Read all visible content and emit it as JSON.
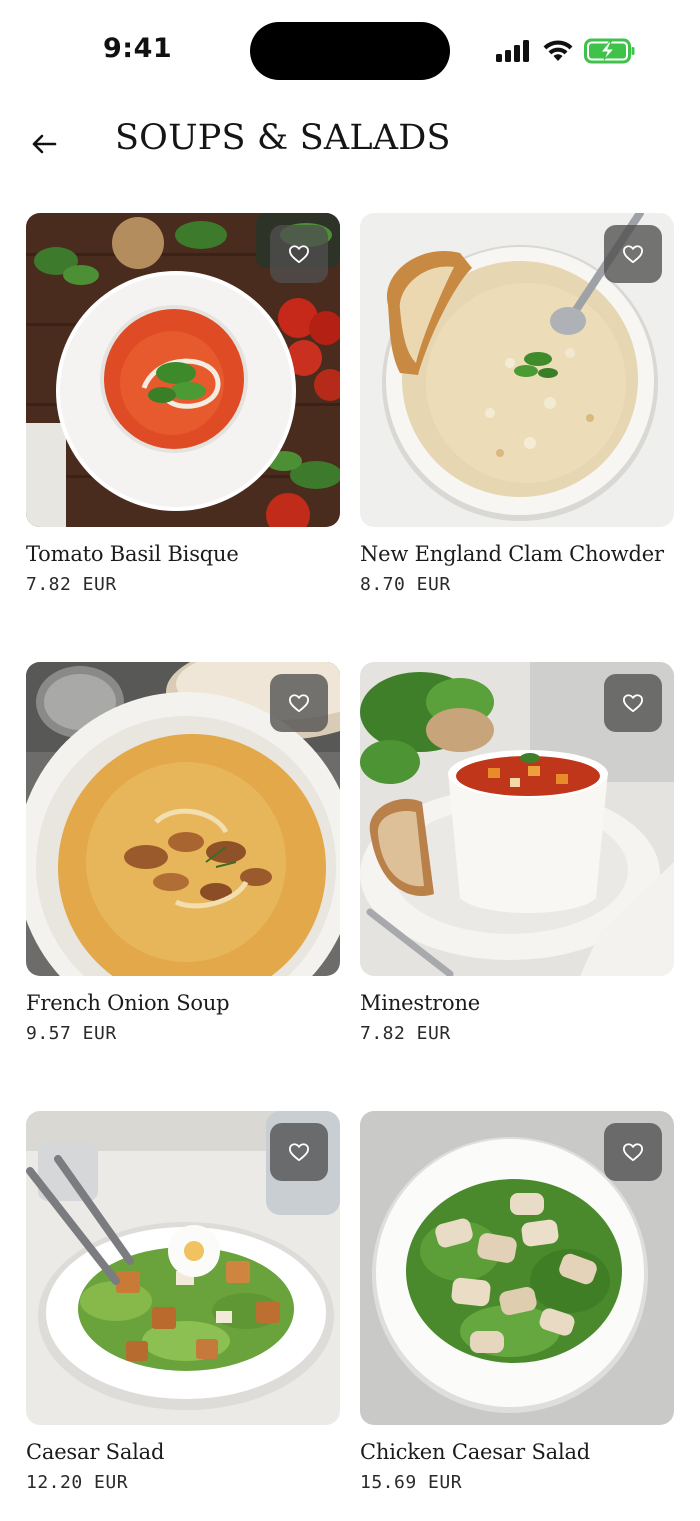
{
  "status_bar": {
    "time": "9:41",
    "icons": [
      "signal-icon",
      "wifi-icon",
      "battery-charging-icon"
    ]
  },
  "header": {
    "back_icon": "arrow-left-icon",
    "title": "SOUPS & SALADS"
  },
  "items": [
    {
      "name": "Tomato Basil Bisque",
      "price": "7.82 EUR",
      "image": "tomato-basil-bisque-photo",
      "favorite_icon": "heart-outline-icon"
    },
    {
      "name": "New England Clam Chowder",
      "price": "8.70 EUR",
      "image": "clam-chowder-photo",
      "favorite_icon": "heart-outline-icon"
    },
    {
      "name": "French Onion Soup",
      "price": "9.57 EUR",
      "image": "french-onion-soup-photo",
      "favorite_icon": "heart-outline-icon"
    },
    {
      "name": "Minestrone",
      "price": "7.82 EUR",
      "image": "minestrone-photo",
      "favorite_icon": "heart-outline-icon"
    },
    {
      "name": "Caesar Salad",
      "price": "12.20 EUR",
      "image": "caesar-salad-photo",
      "favorite_icon": "heart-outline-icon"
    },
    {
      "name": "Chicken Caesar Salad",
      "price": "15.69 EUR",
      "image": "chicken-caesar-salad-photo",
      "favorite_icon": "heart-outline-icon"
    }
  ],
  "colors": {
    "background": "#ffffff",
    "text": "#161616",
    "favorite_button_bg": "#505050"
  }
}
